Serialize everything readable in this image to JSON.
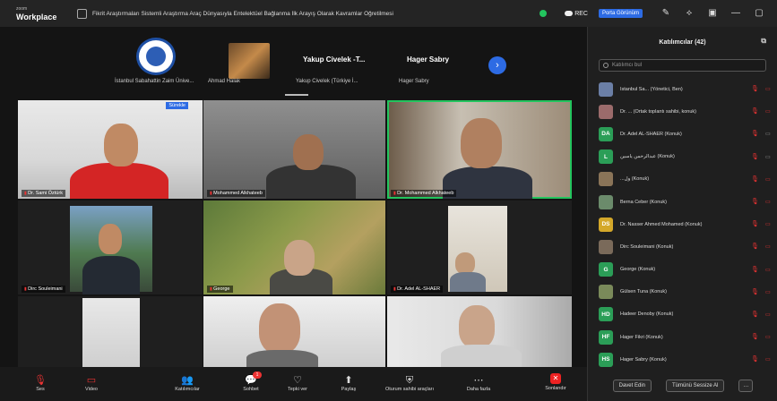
{
  "app": {
    "brand_small": "zoom",
    "brand_big": "Workplace"
  },
  "meeting": {
    "title": "Fikrit Araştırmaları Sistemli Araştırma Araç Dünyasıyla Entelektüel Bağlanma İlk Arayış Olarak Kavramlar Öğretilmesi"
  },
  "topbar": {
    "rec_label": "REC",
    "view_button": "Porta Görünüm"
  },
  "strip": {
    "tiles": [
      {
        "name": "İstanbul Sabahattin Zaim Ünive..."
      },
      {
        "name": "Ahmad Halak"
      },
      {
        "title": "Yakup Civelek -T...",
        "name": "Yakup Civelek (Türkiye İ..."
      },
      {
        "title": "Hager Sabry",
        "name": "Hager Sabry"
      }
    ]
  },
  "gallery": {
    "tiles": [
      {
        "label": "Dr. Sami Öztürk",
        "badge": "Sürekle"
      },
      {
        "label": "Mohammed Alkhateeb"
      },
      {
        "label": "Dr. Mohammed Alkhateeb"
      },
      {
        "label": "Dirc Souleimani"
      },
      {
        "label": "George"
      },
      {
        "label": "Dr. Adel AL-SHAER"
      },
      {
        "label": ""
      },
      {
        "label": ""
      },
      {
        "label": ""
      }
    ]
  },
  "panel": {
    "title": "Katılımcılar (42)",
    "search_placeholder": "Katılımcı bul",
    "participants": [
      {
        "initials": "",
        "name": "Istanbul Sa... (Yönetici, Ben)",
        "color": "#6b7fa6"
      },
      {
        "initials": "",
        "name": "Dr. ... (Ortak toplantı sahibi, konuk)",
        "color": "#9b6b6b"
      },
      {
        "initials": "DA",
        "name": "Dr. Adel AL-SHAER (Konuk)",
        "color": "#2b9e57"
      },
      {
        "initials": "L",
        "name": "عبدالرحمن ياسين (Konuk)",
        "color": "#2b9e57"
      },
      {
        "initials": "",
        "name": "...ول (Konuk)",
        "color": "#8a7458"
      },
      {
        "initials": "",
        "name": "Berna Ceber (Konuk)",
        "color": "#6b8b6b"
      },
      {
        "initials": "DS",
        "name": "Dr. Nasser Ahmed Mohamed (Konuk)",
        "color": "#d4a82a"
      },
      {
        "initials": "",
        "name": "Dirc Souleimani (Konuk)",
        "color": "#7a6a5a"
      },
      {
        "initials": "G",
        "name": "George (Konuk)",
        "color": "#2b9e57"
      },
      {
        "initials": "",
        "name": "Gülsen Tuna (Konuk)",
        "color": "#7a8a5a"
      },
      {
        "initials": "HD",
        "name": "Hadeer Denoby (Konuk)",
        "color": "#2b9e57"
      },
      {
        "initials": "HF",
        "name": "Hager Fikri (Konuk)",
        "color": "#2b9e57"
      },
      {
        "initials": "HS",
        "name": "Hager Sabry (Konuk)",
        "color": "#2b9e57"
      }
    ],
    "invite_button": "Davet Edin",
    "mute_all_button": "Tümünü Sessize Al"
  },
  "toolbar": {
    "items": [
      {
        "label": "Ses"
      },
      {
        "label": "Video"
      },
      {
        "label": "Katılımcılar"
      },
      {
        "label": "Sohbet"
      },
      {
        "label": "Tepki ver"
      },
      {
        "label": "Paylaş"
      },
      {
        "label": "Oturum sahibi araçları"
      },
      {
        "label": "Daha fazla"
      },
      {
        "label": "Sonlandır"
      }
    ],
    "chat_badge": "1",
    "participants_count": "42"
  }
}
